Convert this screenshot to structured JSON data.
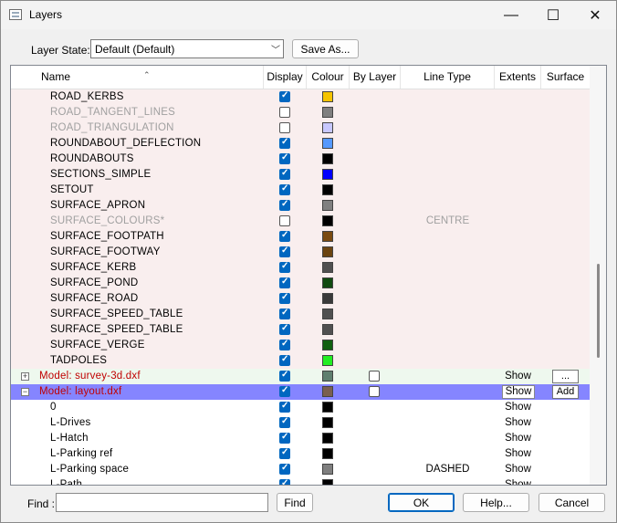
{
  "window": {
    "title": "Layers",
    "minimize": "—",
    "maximize": "☐",
    "close": "✕"
  },
  "layer_state": {
    "label": "Layer State:",
    "value": "Default (Default)",
    "save_as": "Save As..."
  },
  "columns": [
    "Name",
    "Display",
    "Colour",
    "By Layer",
    "Line Type",
    "Extents",
    "Surface"
  ],
  "rows": [
    {
      "name": "ROAD_KERBS",
      "kind": "layer",
      "display": true,
      "colour": "#f5c400",
      "dim": false
    },
    {
      "name": "ROAD_TANGENT_LINES",
      "kind": "layer",
      "display": false,
      "colour": "#7f7f7f",
      "dim": true
    },
    {
      "name": "ROAD_TRIANGULATION",
      "kind": "layer",
      "display": false,
      "colour": "#c8c8ff",
      "dim": true
    },
    {
      "name": "ROUNDABOUT_DEFLECTION",
      "kind": "layer",
      "display": true,
      "colour": "#5599ff",
      "dim": false
    },
    {
      "name": "ROUNDABOUTS",
      "kind": "layer",
      "display": true,
      "colour": "#000000",
      "dim": false
    },
    {
      "name": "SECTIONS_SIMPLE",
      "kind": "layer",
      "display": true,
      "colour": "#0000ff",
      "dim": false
    },
    {
      "name": "SETOUT",
      "kind": "layer",
      "display": true,
      "colour": "#000000",
      "dim": false
    },
    {
      "name": "SURFACE_APRON",
      "kind": "layer",
      "display": true,
      "colour": "#808080",
      "dim": false
    },
    {
      "name": "SURFACE_COLOURS*",
      "kind": "layer",
      "display": false,
      "colour": "#000000",
      "dim": true,
      "linetype": "CENTRE"
    },
    {
      "name": "SURFACE_FOOTPATH",
      "kind": "layer",
      "display": true,
      "colour": "#7a4a10",
      "dim": false
    },
    {
      "name": "SURFACE_FOOTWAY",
      "kind": "layer",
      "display": true,
      "colour": "#6b4410",
      "dim": false
    },
    {
      "name": "SURFACE_KERB",
      "kind": "layer",
      "display": true,
      "colour": "#505050",
      "dim": false
    },
    {
      "name": "SURFACE_POND",
      "kind": "layer",
      "display": true,
      "colour": "#104a10",
      "dim": false
    },
    {
      "name": "SURFACE_ROAD",
      "kind": "layer",
      "display": true,
      "colour": "#3a3a3a",
      "dim": false
    },
    {
      "name": "SURFACE_SPEED_TABLE",
      "kind": "layer",
      "display": true,
      "colour": "#505050",
      "dim": false
    },
    {
      "name": "SURFACE_SPEED_TABLE",
      "kind": "layer",
      "display": true,
      "colour": "#505050",
      "dim": false
    },
    {
      "name": "SURFACE_VERGE",
      "kind": "layer",
      "display": true,
      "colour": "#106010",
      "dim": false
    },
    {
      "name": "TADPOLES",
      "kind": "layer",
      "display": true,
      "colour": "#22ee22",
      "dim": false
    },
    {
      "name": "Model: survey-3d.dxf",
      "kind": "model",
      "expander": "+",
      "display": true,
      "colour": "#5f7f6f",
      "bylayer": false,
      "extents": "Show",
      "surface": "..."
    },
    {
      "name": "Model: layout.dxf",
      "kind": "model-selected",
      "expander": "−",
      "display": true,
      "colour": "#7a5f4f",
      "bylayer": false,
      "extents": "Show",
      "surface": "Add"
    },
    {
      "name": "0",
      "kind": "child",
      "display": true,
      "colour": "#000000",
      "extents": "Show"
    },
    {
      "name": "L-Drives",
      "kind": "child",
      "display": true,
      "colour": "#000000",
      "extents": "Show"
    },
    {
      "name": "L-Hatch",
      "kind": "child",
      "display": true,
      "colour": "#000000",
      "extents": "Show"
    },
    {
      "name": "L-Parking ref",
      "kind": "child",
      "display": true,
      "colour": "#000000",
      "extents": "Show"
    },
    {
      "name": "L-Parking space",
      "kind": "child",
      "display": true,
      "colour": "#7f7f7f",
      "extents": "Show",
      "linetype": "DASHED"
    },
    {
      "name": "L-Path",
      "kind": "child",
      "display": true,
      "colour": "#000000",
      "extents": "Show"
    }
  ],
  "colors": {
    "layer_bg": "#f9eeee",
    "model_bg": "#eef8ee",
    "selected_bg": "#8585ff",
    "model_text": "#c00000",
    "dim_text": "#a0a0a0"
  },
  "footer": {
    "find_label": "Find :",
    "find_value": "",
    "find_button": "Find",
    "ok": "OK",
    "help": "Help...",
    "cancel": "Cancel"
  }
}
